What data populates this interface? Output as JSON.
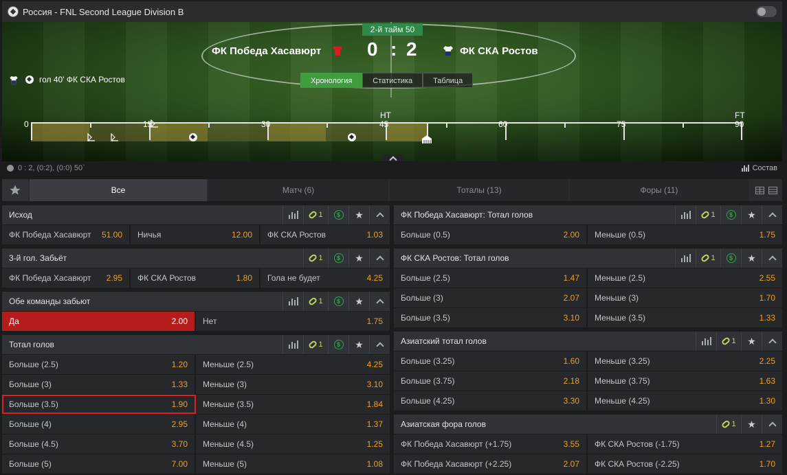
{
  "header": {
    "title": "Россия - FNL Second League Division B"
  },
  "match": {
    "period": "2-й тайм 50",
    "home": "ФК Победа Хасавюрт",
    "away": "ФК СКА Ростов",
    "score_home": "0",
    "score_sep": ":",
    "score_away": "2",
    "last_event": "гол 40' ФК СКА Ростов",
    "views": [
      "Хронология",
      "Статистика",
      "Таблица"
    ],
    "timeline": {
      "labels": [
        "0",
        "15",
        "30",
        "45",
        "60",
        "75",
        "90"
      ],
      "ht": "HT",
      "ft": "FT"
    },
    "status_line": "0 : 2, (0:2), (0:0) 50`",
    "lineup_label": "Состав"
  },
  "tabs": [
    "Все",
    "Матч (6)",
    "Тоталы (13)",
    "Форы (11)"
  ],
  "left_markets": [
    {
      "title": "Исход",
      "link_count": "1",
      "rows": [
        [
          [
            "ФК Победа Хасавюрт",
            "51.00"
          ],
          [
            "Ничья",
            "12.00"
          ],
          [
            "ФК СКА Ростов",
            "1.03"
          ]
        ]
      ]
    },
    {
      "title": "3-й гол. Забьёт",
      "link_count": "1",
      "rows": [
        [
          [
            "ФК Победа Хасавюрт",
            "2.95"
          ],
          [
            "ФК СКА Ростов",
            "1.80"
          ],
          [
            "Гола не будет",
            "4.25"
          ]
        ]
      ]
    },
    {
      "title": "Обе команды забьют",
      "link_count": "1",
      "rows": [
        [
          [
            "Да",
            "2.00"
          ],
          [
            "Нет",
            "1.75"
          ]
        ]
      ]
    },
    {
      "title": "Тотал голов",
      "link_count": "1",
      "rows": [
        [
          [
            "Больше (2.5)",
            "1.20"
          ],
          [
            "Меньше (2.5)",
            "4.25"
          ]
        ],
        [
          [
            "Больше (3)",
            "1.33"
          ],
          [
            "Меньше (3)",
            "3.10"
          ]
        ],
        [
          [
            "Больше (3.5)",
            "1.90"
          ],
          [
            "Меньше (3.5)",
            "1.84"
          ]
        ],
        [
          [
            "Больше (4)",
            "2.95"
          ],
          [
            "Меньше (4)",
            "1.37"
          ]
        ],
        [
          [
            "Больше (4.5)",
            "3.70"
          ],
          [
            "Меньше (4.5)",
            "1.25"
          ]
        ],
        [
          [
            "Больше (5)",
            "7.00"
          ],
          [
            "Меньше (5)",
            "1.08"
          ]
        ]
      ]
    }
  ],
  "right_markets": [
    {
      "title": "ФК Победа Хасавюрт: Тотал голов",
      "link_count": "1",
      "rows": [
        [
          [
            "Больше (0.5)",
            "2.00"
          ],
          [
            "Меньше (0.5)",
            "1.75"
          ]
        ]
      ]
    },
    {
      "title": "ФК СКА Ростов: Тотал голов",
      "link_count": "1",
      "rows": [
        [
          [
            "Больше (2.5)",
            "1.47"
          ],
          [
            "Меньше (2.5)",
            "2.55"
          ]
        ],
        [
          [
            "Больше (3)",
            "2.07"
          ],
          [
            "Меньше (3)",
            "1.70"
          ]
        ],
        [
          [
            "Больше (3.5)",
            "3.10"
          ],
          [
            "Меньше (3.5)",
            "1.33"
          ]
        ]
      ]
    },
    {
      "title": "Азиатский тотал голов",
      "link_count": "1",
      "rows": [
        [
          [
            "Больше (3.25)",
            "1.60"
          ],
          [
            "Меньше (3.25)",
            "2.25"
          ]
        ],
        [
          [
            "Больше (3.75)",
            "2.18"
          ],
          [
            "Меньше (3.75)",
            "1.63"
          ]
        ],
        [
          [
            "Больше (4.25)",
            "3.30"
          ],
          [
            "Меньше (4.25)",
            "1.30"
          ]
        ]
      ]
    },
    {
      "title": "Азиатская фора голов",
      "link_count": "1",
      "rows": [
        [
          [
            "ФК Победа Хасавюрт (+1.75)",
            "3.55"
          ],
          [
            "ФК СКА Ростов (-1.75)",
            "1.27"
          ]
        ],
        [
          [
            "ФК Победа Хасавюрт (+2.25)",
            "2.07"
          ],
          [
            "ФК СКА Ростов (-2.25)",
            "1.70"
          ]
        ]
      ]
    }
  ],
  "colors": {
    "accent_green": "#3f9c3f",
    "odds": "#f0a020",
    "selected": "#b51d1d"
  }
}
